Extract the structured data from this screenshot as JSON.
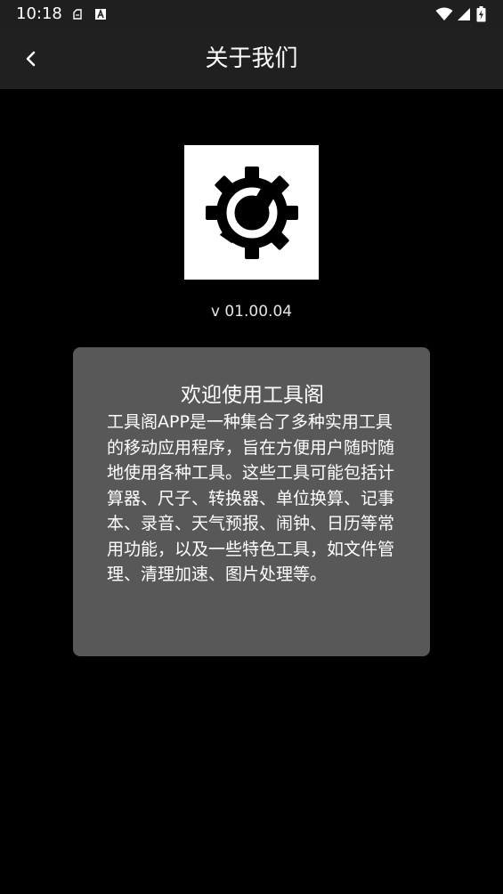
{
  "status_bar": {
    "time": "10:18"
  },
  "app_bar": {
    "title": "关于我们",
    "back_icon": "chevron-left-icon"
  },
  "about": {
    "logo_icon": "gear-wrench-icon",
    "version": "v 01.00.04",
    "card_title": "欢迎使用工具阁",
    "card_body": "工具阁APP是一种集合了多种实用工具的移动应用程序，旨在方便用户随时随地使用各种工具。这些工具可能包括计算器、尺子、转换器、单位换算、记事本、录音、天气预报、闹钟、日历等常用功能，以及一些特色工具，如文件管理、清理加速、图片处理等。"
  },
  "colors": {
    "background": "#000000",
    "app_bar": "#202020",
    "card": "#595858",
    "text": "#ffffff"
  }
}
